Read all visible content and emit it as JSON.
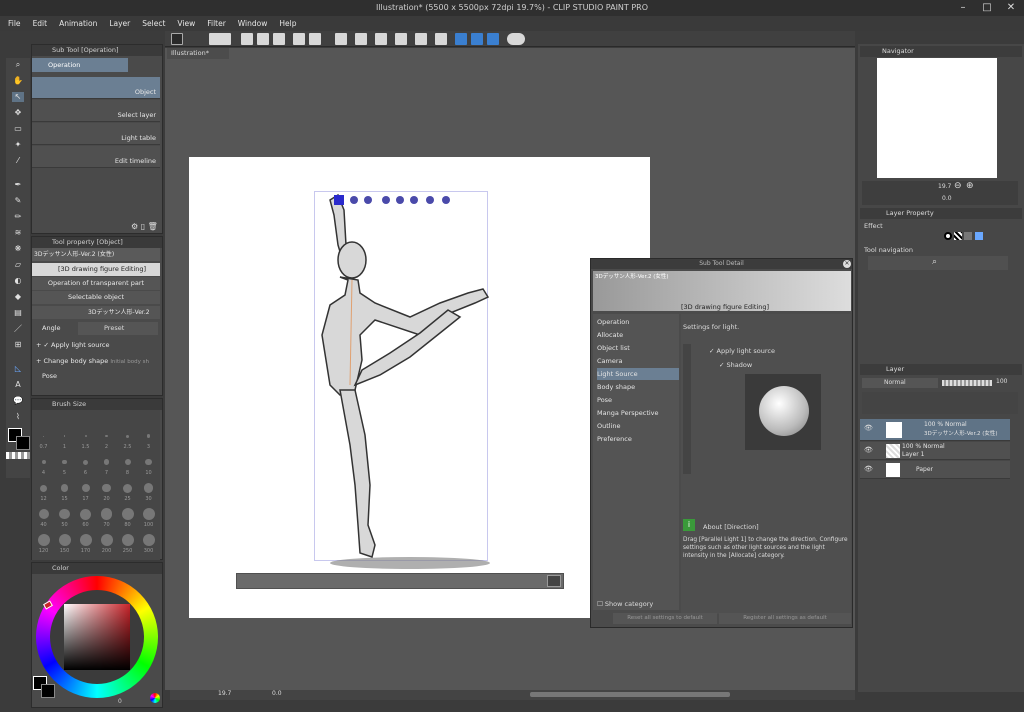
{
  "window": {
    "title": "Illustration* (5500 x 5500px 72dpi 19.7%) - CLIP STUDIO PAINT PRO"
  },
  "menu": [
    "File",
    "Edit",
    "Animation",
    "Layer",
    "Select",
    "View",
    "Filter",
    "Window",
    "Help"
  ],
  "subtool": {
    "header": "Sub Tool [Operation]",
    "group": "Operation",
    "items": [
      "Object",
      "Select layer",
      "Light table",
      "Edit timeline"
    ]
  },
  "toolprop": {
    "header": "Tool property [Object]",
    "name_field": "3Dデッサン人形-Ver.2 (女性)",
    "mode": "[3D drawing figure Editing]",
    "rows": [
      "Operation of transparent part",
      "Selectable object",
      "3Dデッサン人形-Ver.2",
      "Angle",
      "Preset",
      "Apply light source",
      "Change body shape",
      "Pose"
    ],
    "initial_body": "Initial body sh"
  },
  "brushsize": {
    "header": "Brush Size",
    "values": [
      "0.7",
      "1",
      "1.5",
      "2",
      "2.5",
      "3",
      "4",
      "5",
      "6",
      "7",
      "8",
      "10",
      "12",
      "15",
      "17",
      "20",
      "25",
      "30",
      "40",
      "50",
      "60",
      "70",
      "80",
      "100",
      "120",
      "150",
      "170",
      "200",
      "250",
      "300"
    ]
  },
  "color": {
    "header": "Color",
    "fg": "#000000",
    "bg": "#ffffff",
    "hue": "#c8242a",
    "readout": "0"
  },
  "canvas": {
    "tab": "Illustration*",
    "zoom": "19.7",
    "angle": "0.0"
  },
  "dialog": {
    "title": "Sub Tool Detail",
    "name": "3Dデッサン人形-Ver.2 (女性)",
    "mode": "[3D drawing figure Editing]",
    "categories": [
      "Operation",
      "Allocate",
      "Object list",
      "Camera",
      "Light Source",
      "Body shape",
      "Pose",
      "Manga Perspective",
      "Outline",
      "Preference"
    ],
    "selected": "Light Source",
    "settings_heading": "Settings for light.",
    "apply_light": "Apply light source",
    "shadow": "Shadow",
    "about_title": "About [Direction]",
    "about_text": "Drag [Parallel Light 1] to change the direction. Configure settings such as other light sources and the light intensity in the [Allocate] category.",
    "show_category": "Show category",
    "btn_reset": "Reset all settings to default",
    "btn_register": "Register all settings as default"
  },
  "navigator": {
    "header": "Navigator",
    "zoom": "19.7",
    "angle": "0.0"
  },
  "layerprop": {
    "header": "Layer Property",
    "effect": "Effect",
    "tool_nav": "Tool navigation"
  },
  "layers": {
    "header": "Layer",
    "blend": "Normal",
    "opacity": "100",
    "rows": [
      {
        "line1": "100 % Normal",
        "line2": "3Dデッサン人形-Ver.2 (女性)",
        "selected": true
      },
      {
        "line1": "100 % Normal",
        "line2": "Layer 1",
        "selected": false
      },
      {
        "line1": "Paper",
        "line2": "",
        "selected": false
      }
    ]
  }
}
